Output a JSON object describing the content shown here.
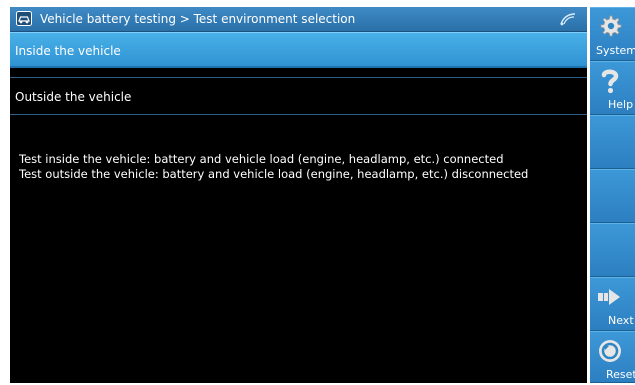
{
  "window": {
    "title": "Vehicle battery testing > Test environment selection"
  },
  "options": [
    {
      "label": "Inside the vehicle",
      "selected": true
    },
    {
      "label": "Outside the vehicle",
      "selected": false
    }
  ],
  "description": {
    "line1": "Test inside the vehicle: battery and vehicle load (engine, headlamp, etc.) connected",
    "line2": "Test outside the vehicle: battery and vehicle load (engine, headlamp, etc.) disconnected"
  },
  "sidebar": {
    "system_label": "System",
    "help_label": "Help",
    "next_label": "Next",
    "reset_label": "Reset"
  },
  "colors": {
    "accent": "#3a9ad9",
    "selected_row": "#3aa3e0",
    "sidebar": "#2f86c5",
    "background": "#000000"
  },
  "icons": {
    "title": "vehicle-app-icon",
    "status": "signal-icon",
    "system": "gear-icon",
    "help": "question-icon",
    "next": "arrow-right-icon",
    "reset": "reset-icon"
  }
}
